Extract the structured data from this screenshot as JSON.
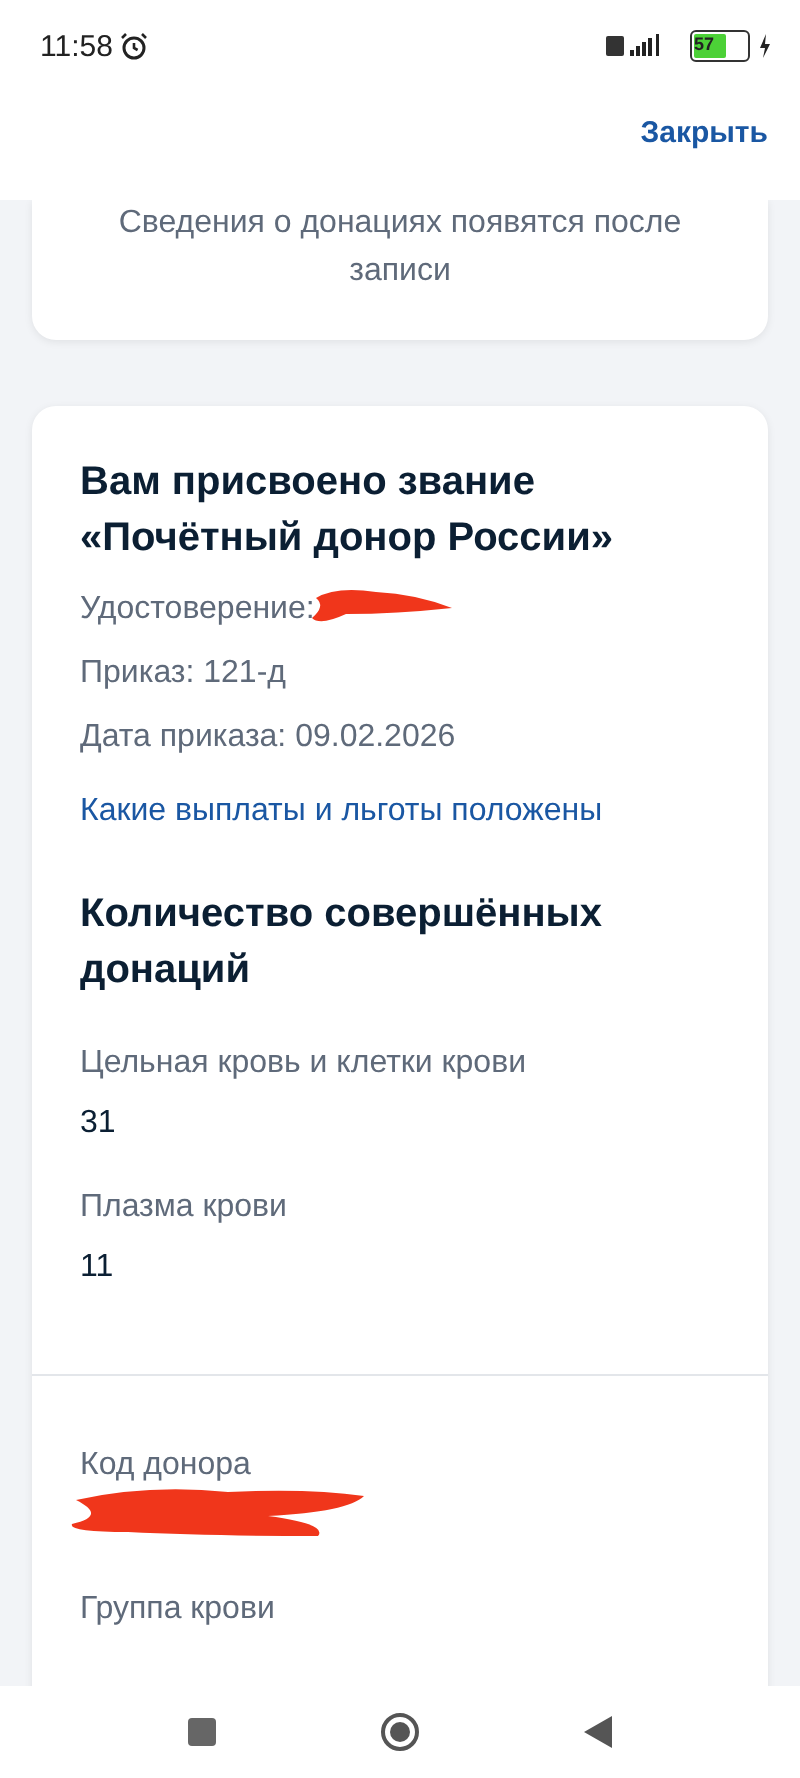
{
  "status_bar": {
    "time": "11:58",
    "battery": "57"
  },
  "header": {
    "close": "Закрыть"
  },
  "notice": "Сведения о донациях появятся после записи",
  "title_card": {
    "title": "Вам присвоено звание «Почётный донор России»",
    "details": [
      {
        "kind": "redacted",
        "label": "Удостоверение:"
      },
      {
        "kind": "text",
        "label": "Приказ: 121-д"
      },
      {
        "kind": "text",
        "label": "Дата приказа: 09.02.2026"
      }
    ],
    "link": "Какие выплаты и льготы положены"
  },
  "donations": {
    "title": "Количество совершённых донаций",
    "items": [
      {
        "label": "Цельная кровь и клетки крови",
        "value": "31"
      },
      {
        "label": "Плазма крови",
        "value": "11"
      }
    ]
  },
  "donor": [
    {
      "kind": "redacted",
      "label": "Код донора"
    },
    {
      "kind": "text",
      "label": "Группа крови"
    }
  ]
}
